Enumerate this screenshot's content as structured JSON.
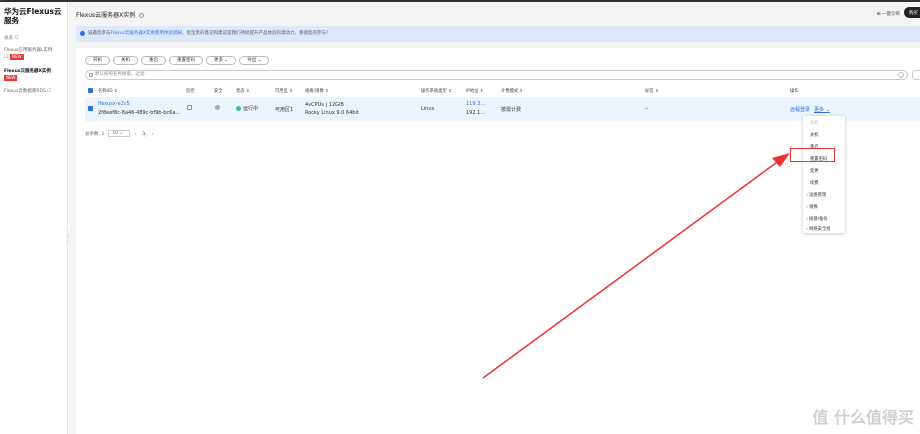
{
  "sidebar": {
    "title": "华为云Flexus云服务",
    "items": [
      {
        "label": "总览"
      },
      {
        "label": "Flexus应用服务器L实例",
        "badge": "NEW"
      },
      {
        "label": "Flexus云服务器X实例",
        "badge": "NEW"
      },
      {
        "label": "Flexus云数据库RDS"
      }
    ]
  },
  "header": {
    "title": "Flexus云服务器X实例",
    "diagnose": "一键诊断",
    "buy": "购买"
  },
  "banner": {
    "prefix": "诚邀您参与",
    "link": "Flexus云服务器X实例使用体验调研",
    "suffix": "，您宝贵的意见和建议是我们持续提升产品体验的源动力，感谢您的参与！"
  },
  "toolbar": {
    "buttons": [
      "开机",
      "关机",
      "重启",
      "重置密码",
      "更多 ⌄",
      "导出 ⌄"
    ]
  },
  "search": {
    "placeholder": "默认按照名称搜索、过滤"
  },
  "table": {
    "headers": [
      "名称/ID ⇕",
      "监控",
      "安全",
      "状态 ⇕",
      "可用区 ⇕",
      "规格/镜像 ⇕",
      "操作系统类型 ⇕",
      "IP地址 ⇕",
      "计费模式 ⇕",
      "标签 ⇕",
      "操作"
    ],
    "row": {
      "name": "flexusx-e2c5",
      "id": "2f8eef8c-8a46-489c-bf9b-bc6a...",
      "status": "运行中",
      "zone": "可用区1",
      "spec": "4vCPUs | 12GiB",
      "image": "Rocky Linux 9.0 64bit",
      "os": "Linux",
      "ip1": "119.3...",
      "ip2": "192.1...",
      "billing": "按需计费",
      "tags": "--",
      "remote": "远程登录",
      "more": "更多 ⌄"
    }
  },
  "pager": {
    "total": "总条数: 1",
    "size": "10 ⌄",
    "page": "1"
  },
  "menu": {
    "items": [
      "开机",
      "关机",
      "重启",
      "重置密码",
      "变更",
      "续费",
      "‹ 运维管理",
      "‹ 镜像",
      "‹ 磁盘/备份",
      "‹ 网络安全组"
    ]
  },
  "watermark": "值 什么值得买"
}
